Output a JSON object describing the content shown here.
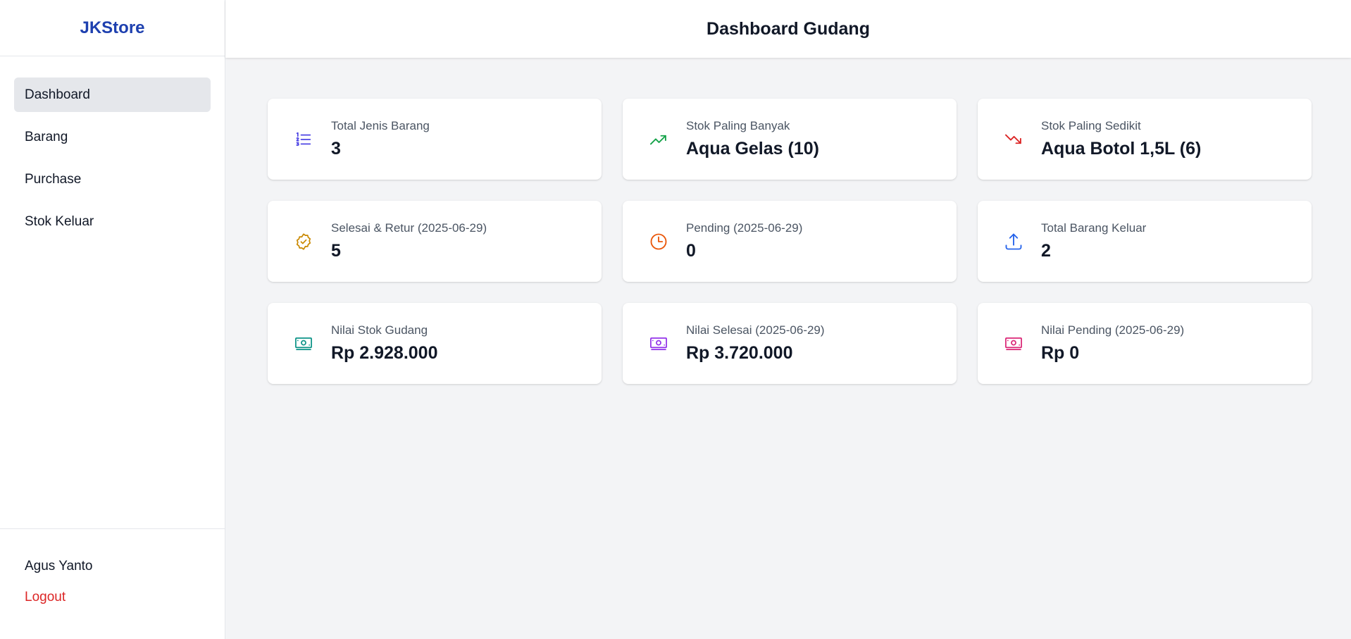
{
  "sidebar": {
    "brand": "JKStore",
    "items": [
      {
        "label": "Dashboard"
      },
      {
        "label": "Barang"
      },
      {
        "label": "Purchase"
      },
      {
        "label": "Stok Keluar"
      }
    ],
    "user_name": "Agus Yanto",
    "logout_label": "Logout"
  },
  "header": {
    "title": "Dashboard Gudang"
  },
  "cards": [
    {
      "label": "Total Jenis Barang",
      "value": "3",
      "icon": "list-icon",
      "color": "#4f46e5"
    },
    {
      "label": "Stok Paling Banyak",
      "value": "Aqua Gelas (10)",
      "icon": "trending-up-icon",
      "color": "#16a34a"
    },
    {
      "label": "Stok Paling Sedikit",
      "value": "Aqua Botol 1,5L (6)",
      "icon": "trending-down-icon",
      "color": "#dc2626"
    },
    {
      "label": "Selesai & Retur (2025-06-29)",
      "value": "5",
      "icon": "check-badge-icon",
      "color": "#ca8a04"
    },
    {
      "label": "Pending (2025-06-29)",
      "value": "0",
      "icon": "clock-icon",
      "color": "#ea580c"
    },
    {
      "label": "Total Barang Keluar",
      "value": "2",
      "icon": "upload-icon",
      "color": "#2563eb"
    },
    {
      "label": "Nilai Stok Gudang",
      "value": "Rp 2.928.000",
      "icon": "banknotes-icon",
      "color": "#0d9488"
    },
    {
      "label": "Nilai Selesai (2025-06-29)",
      "value": "Rp 3.720.000",
      "icon": "banknotes-icon",
      "color": "#9333ea"
    },
    {
      "label": "Nilai Pending (2025-06-29)",
      "value": "Rp 0",
      "icon": "banknotes-icon",
      "color": "#db2777"
    }
  ]
}
